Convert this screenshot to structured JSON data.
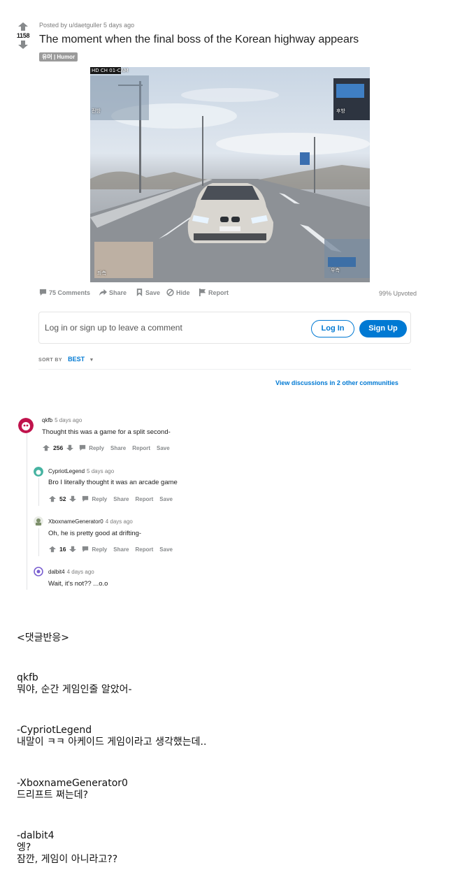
{
  "post": {
    "score": "1158",
    "meta": "Posted by u/daetguller 5 days ago",
    "title": "The moment when the final boss of the Korean highway appears",
    "flair": "유머 | Humor"
  },
  "media": {
    "overlay_top_left": "HD CH 01-CAM",
    "label_front": "전방",
    "label_rear": "후방",
    "label_left": "좌측",
    "label_right": "우측"
  },
  "actions": {
    "comments": "75 Comments",
    "share": "Share",
    "save": "Save",
    "hide": "Hide",
    "report": "Report",
    "upvoted": "99% Upvoted"
  },
  "login": {
    "prompt": "Log in or sign up to leave a comment",
    "login_label": "Log In",
    "signup_label": "Sign Up"
  },
  "sort": {
    "label": "SORT BY",
    "value": "BEST"
  },
  "view_discussions": "View discussions in 2 other communities",
  "comments": [
    {
      "author": "qkfb",
      "time": "5 days ago",
      "body": "Thought this was a game for a split second-",
      "score": "256",
      "reply": "Reply",
      "share": "Share",
      "report": "Report",
      "save": "Save",
      "avatar_color": "#c0134c"
    },
    {
      "author": "CypriotLegend",
      "time": "5 days ago",
      "body": "Bro I literally thought it was an arcade game",
      "score": "52",
      "reply": "Reply",
      "share": "Share",
      "report": "Report",
      "save": "Save",
      "avatar_color": "#46b3a1"
    },
    {
      "author": "XboxnameGenerator0",
      "time": "4 days ago",
      "body": "Oh, he is pretty good at drifting-",
      "score": "16",
      "reply": "Reply",
      "share": "Share",
      "report": "Report",
      "save": "Save",
      "avatar_color": "#7c8f6a"
    },
    {
      "author": "dalbit4",
      "time": "4 days ago",
      "body": "Wait, it's not?? ...o.o",
      "avatar_color": "#7a5fd0"
    }
  ],
  "translation": {
    "header": "<댓글반응>",
    "entries": [
      {
        "name": "qkfb",
        "lines": [
          "뭐야, 순간 게임인줄 알았어-"
        ]
      },
      {
        "name": "-CypriotLegend",
        "lines": [
          "내말이 ㅋㅋ 아케이드 게임이라고 생각했는데.."
        ]
      },
      {
        "name": "-XboxnameGenerator0",
        "lines": [
          "드리프트 쩌는데?"
        ]
      },
      {
        "name": "-dalbit4",
        "lines": [
          "엥?",
          "잠깐, 게임이 아니라고??"
        ]
      }
    ]
  }
}
